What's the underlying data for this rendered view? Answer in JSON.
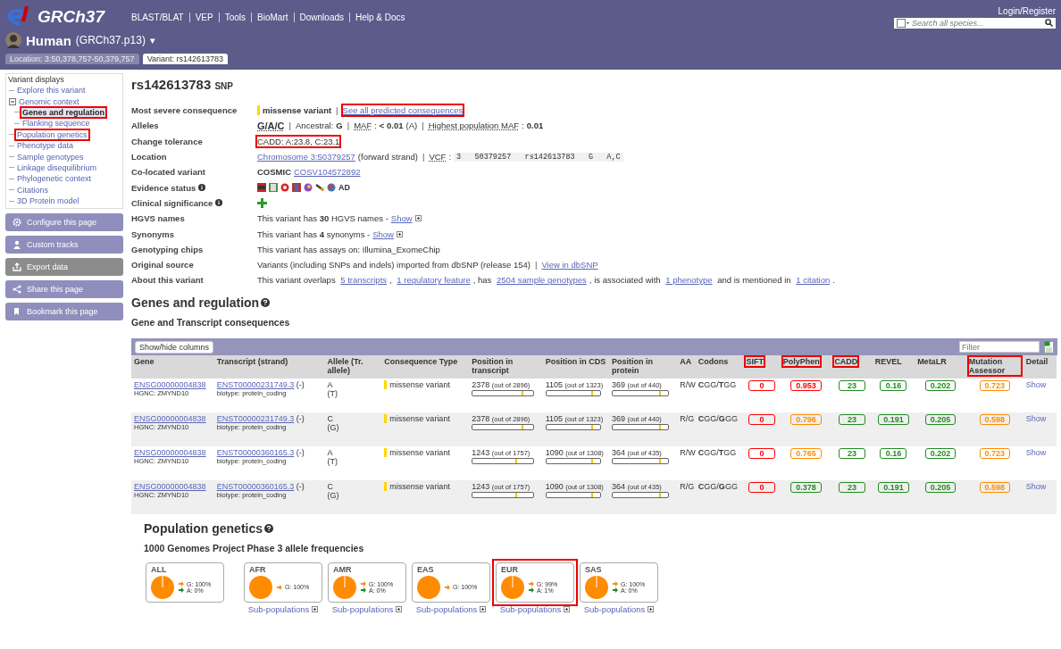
{
  "header": {
    "logo": "GRCh37",
    "nav": [
      "BLAST/BLAT",
      "VEP",
      "Tools",
      "BioMart",
      "Downloads",
      "Help & Docs"
    ],
    "login": "Login/Register",
    "search": {
      "placeholder": "Search all species..."
    },
    "species": "Human",
    "assembly": "(GRCh37.p13)",
    "caret": "▾"
  },
  "tabs": [
    {
      "label": "Location: 3:50,378,757-50,379,757",
      "selected": false
    },
    {
      "label": "Variant: rs142613783",
      "selected": true
    }
  ],
  "sidebar": {
    "title": "Variant displays",
    "items": [
      {
        "label": "Explore this variant",
        "selected": false,
        "highlighted": false
      },
      {
        "label": "Genomic context",
        "selected": false,
        "highlighted": false,
        "expanded": true,
        "children": [
          {
            "label": "Genes and regulation",
            "selected": true,
            "highlighted": true
          },
          {
            "label": "Flanking sequence",
            "selected": false,
            "highlighted": false
          }
        ]
      },
      {
        "label": "Population genetics",
        "selected": false,
        "highlighted": true
      },
      {
        "label": "Phenotype data",
        "selected": false,
        "highlighted": false
      },
      {
        "label": "Sample genotypes",
        "selected": false,
        "highlighted": false
      },
      {
        "label": "Linkage disequilibrium",
        "selected": false,
        "highlighted": false
      },
      {
        "label": "Phylogenetic context",
        "selected": false,
        "highlighted": false
      },
      {
        "label": "Citations",
        "selected": false,
        "highlighted": false
      },
      {
        "label": "3D Protein model",
        "selected": false,
        "highlighted": false
      }
    ],
    "buttons": [
      {
        "label": "Configure this page",
        "kind": "gear",
        "disabled": false
      },
      {
        "label": "Custom tracks",
        "kind": "tracks",
        "disabled": false
      },
      {
        "label": "Export data",
        "kind": "export",
        "disabled": true
      },
      {
        "label": "Share this page",
        "kind": "share",
        "disabled": false
      },
      {
        "label": "Bookmark this page",
        "kind": "bookmark",
        "disabled": false
      }
    ]
  },
  "variant": {
    "id": "rs142613783",
    "type": "SNP"
  },
  "summary": [
    {
      "label": "Most severe consequence",
      "info": false,
      "parts": [
        {
          "kind": "tag",
          "text": "missense variant",
          "color": "#ffd700"
        },
        {
          "kind": "sep",
          "text": "|"
        },
        {
          "kind": "link",
          "text": "See all predicted consequences",
          "highlighted": true
        }
      ]
    },
    {
      "label": "Alleles",
      "info": false,
      "parts": [
        {
          "kind": "boldabbr",
          "text": "G/A/C"
        },
        {
          "kind": "sep",
          "text": "|"
        },
        {
          "kind": "text",
          "text": "Ancestral:"
        },
        {
          "kind": "bold",
          "text": "G"
        },
        {
          "kind": "sep",
          "text": "|"
        },
        {
          "kind": "abbr",
          "text": "MAF"
        },
        {
          "kind": "text",
          "text": ":"
        },
        {
          "kind": "bold",
          "text": "< 0.01"
        },
        {
          "kind": "text",
          "text": "(A)"
        },
        {
          "kind": "sep",
          "text": "|"
        },
        {
          "kind": "abbr",
          "text": "Highest population MAF"
        },
        {
          "kind": "text",
          "text": ":"
        },
        {
          "kind": "bold",
          "text": "0.01"
        }
      ]
    },
    {
      "label": "Change tolerance",
      "info": false,
      "parts": [
        {
          "kind": "text",
          "text": "CADD: A:23.8, C:23.1",
          "highlighted": true
        }
      ]
    },
    {
      "label": "Location",
      "info": false,
      "parts": [
        {
          "kind": "link",
          "text": "Chromosome 3:50379257"
        },
        {
          "kind": "text",
          "text": "(forward strand)"
        },
        {
          "kind": "sep",
          "text": "|"
        },
        {
          "kind": "abbr",
          "text": "VCF"
        },
        {
          "kind": "text",
          "text": ":"
        },
        {
          "kind": "code",
          "text": "3   50379257   rs142613783   G   A,C"
        }
      ]
    },
    {
      "label": "Co-located variant",
      "info": false,
      "parts": [
        {
          "kind": "bold",
          "text": "COSMIC"
        },
        {
          "kind": "link",
          "text": "COSV104572892"
        }
      ]
    },
    {
      "label": "Evidence status",
      "info": true,
      "parts": [
        {
          "kind": "evidence",
          "text": "AD"
        }
      ]
    },
    {
      "label": "Clinical significance",
      "info": true,
      "parts": [
        {
          "kind": "plus"
        }
      ]
    },
    {
      "label": "HGVS names",
      "info": false,
      "parts": [
        {
          "kind": "rich",
          "text": "This variant has **30** HGVS names -"
        },
        {
          "kind": "link",
          "text": "Show"
        },
        {
          "kind": "toggle"
        }
      ]
    },
    {
      "label": "Synonyms",
      "info": false,
      "parts": [
        {
          "kind": "rich",
          "text": "This variant has **4** synonyms -"
        },
        {
          "kind": "link",
          "text": "Show"
        },
        {
          "kind": "toggle"
        }
      ]
    },
    {
      "label": "Genotyping chips",
      "info": false,
      "parts": [
        {
          "kind": "text",
          "text": "This variant has assays on: Illumina_ExomeChip"
        }
      ]
    },
    {
      "label": "Original source",
      "info": false,
      "parts": [
        {
          "kind": "text",
          "text": "Variants (including SNPs and indels) imported from dbSNP (release 154)"
        },
        {
          "kind": "sep",
          "text": "|"
        },
        {
          "kind": "extlink",
          "text": "View in dbSNP"
        }
      ]
    },
    {
      "label": "About this variant",
      "info": false,
      "parts": [
        {
          "kind": "text",
          "text": "This variant overlaps "
        },
        {
          "kind": "link",
          "text": "5 transcripts"
        },
        {
          "kind": "text",
          "text": ", "
        },
        {
          "kind": "link",
          "text": "1 regulatory feature"
        },
        {
          "kind": "text",
          "text": ", has "
        },
        {
          "kind": "link",
          "text": "2504 sample genotypes"
        },
        {
          "kind": "text",
          "text": ", is associated with "
        },
        {
          "kind": "link",
          "text": "1 phenotype"
        },
        {
          "kind": "text",
          "text": " and is mentioned in "
        },
        {
          "kind": "link",
          "text": "1 citation"
        },
        {
          "kind": "text",
          "text": "."
        }
      ]
    }
  ],
  "genes": {
    "title": "Genes and regulation",
    "subtitle": "Gene and Transcript consequences",
    "toolbar": {
      "button": "Show/hide columns",
      "filter": {
        "placeholder": "Filter"
      }
    },
    "columns": [
      {
        "label": "Gene",
        "highlighted": false
      },
      {
        "label": "Transcript (strand)",
        "highlighted": false
      },
      {
        "label": "Allele (Tr. allele)",
        "highlighted": false
      },
      {
        "label": "Consequence Type",
        "highlighted": false
      },
      {
        "label": "Position in transcript",
        "highlighted": false
      },
      {
        "label": "Position in CDS",
        "highlighted": false
      },
      {
        "label": "Position in protein",
        "highlighted": false
      },
      {
        "label": "AA",
        "highlighted": false
      },
      {
        "label": "Codons",
        "highlighted": false
      },
      {
        "label": "SIFT",
        "highlighted": true
      },
      {
        "label": "PolyPhen",
        "highlighted": true
      },
      {
        "label": "CADD",
        "highlighted": true
      },
      {
        "label": "REVEL",
        "highlighted": false
      },
      {
        "label": "MetaLR",
        "highlighted": false
      },
      {
        "label": "Mutation Assessor",
        "highlighted": true
      },
      {
        "label": "Detail",
        "highlighted": false
      }
    ],
    "rows": [
      {
        "gene": "ENSG00000004838",
        "hgnc": "HGNC: ZMYND10",
        "transcript": "ENST00000231749.3",
        "strand": "(-)",
        "biotype_label": "biotype:",
        "biotype": "protein_coding",
        "allele": "A",
        "tr_allele": "(T)",
        "consequence": {
          "text": "missense variant",
          "color": "#ffd700"
        },
        "positions": [
          {
            "value": "2378",
            "total": "(out of 2896)",
            "level": 0.82
          },
          {
            "value": "1105",
            "total": "(out of 1323)",
            "level": 0.84
          },
          {
            "value": "369",
            "total": "(out of 440)",
            "level": 0.84
          }
        ],
        "aa": "R/W",
        "codons": "**C**GG/**T**GG",
        "scores": [
          {
            "text": "0",
            "color": "#ff0000"
          },
          {
            "text": "0.953",
            "color": "#ff0000"
          },
          {
            "text": "23",
            "color": "#228b22"
          },
          {
            "text": "0.16",
            "color": "#228b22"
          },
          {
            "text": "0.202",
            "color": "#228b22"
          },
          {
            "text": "0.723",
            "color": "#ff8c00"
          }
        ],
        "detail": "Show"
      },
      {
        "gene": "ENSG00000004838",
        "hgnc": "HGNC: ZMYND10",
        "transcript": "ENST00000231749.3",
        "strand": "(-)",
        "biotype_label": "biotype:",
        "biotype": "protein_coding",
        "allele": "C",
        "tr_allele": "(G)",
        "consequence": {
          "text": "missense variant",
          "color": "#ffd700"
        },
        "positions": [
          {
            "value": "2378",
            "total": "(out of 2896)",
            "level": 0.82
          },
          {
            "value": "1105",
            "total": "(out of 1323)",
            "level": 0.84
          },
          {
            "value": "369",
            "total": "(out of 440)",
            "level": 0.84
          }
        ],
        "aa": "R/G",
        "codons": "**C**GG/**G**GG",
        "scores": [
          {
            "text": "0",
            "color": "#ff0000"
          },
          {
            "text": "0.796",
            "color": "#ff8c00"
          },
          {
            "text": "23",
            "color": "#228b22"
          },
          {
            "text": "0.191",
            "color": "#228b22"
          },
          {
            "text": "0.205",
            "color": "#228b22"
          },
          {
            "text": "0.598",
            "color": "#ff8c00"
          }
        ],
        "detail": "Show"
      },
      {
        "gene": "ENSG00000004838",
        "hgnc": "HGNC: ZMYND10",
        "transcript": "ENST00000360165.3",
        "strand": "(-)",
        "biotype_label": "biotype:",
        "biotype": "protein_coding",
        "allele": "A",
        "tr_allele": "(T)",
        "consequence": {
          "text": "missense variant",
          "color": "#ffd700"
        },
        "positions": [
          {
            "value": "1243",
            "total": "(out of 1757)",
            "level": 0.71
          },
          {
            "value": "1090",
            "total": "(out of 1308)",
            "level": 0.83
          },
          {
            "value": "364",
            "total": "(out of 435)",
            "level": 0.84
          }
        ],
        "aa": "R/W",
        "codons": "**C**GG/**T**GG",
        "scores": [
          {
            "text": "0",
            "color": "#ff0000"
          },
          {
            "text": "0.765",
            "color": "#ff8c00"
          },
          {
            "text": "23",
            "color": "#228b22"
          },
          {
            "text": "0.16",
            "color": "#228b22"
          },
          {
            "text": "0.202",
            "color": "#228b22"
          },
          {
            "text": "0.723",
            "color": "#ff8c00"
          }
        ],
        "detail": "Show"
      },
      {
        "gene": "ENSG00000004838",
        "hgnc": "HGNC: ZMYND10",
        "transcript": "ENST00000360165.3",
        "strand": "(-)",
        "biotype_label": "biotype:",
        "biotype": "protein_coding",
        "allele": "C",
        "tr_allele": "(G)",
        "consequence": {
          "text": "missense variant",
          "color": "#ffd700"
        },
        "positions": [
          {
            "value": "1243",
            "total": "(out of 1757)",
            "level": 0.71
          },
          {
            "value": "1090",
            "total": "(out of 1308)",
            "level": 0.83
          },
          {
            "value": "364",
            "total": "(out of 435)",
            "level": 0.84
          }
        ],
        "aa": "R/G",
        "codons": "**C**GG/**G**GG",
        "scores": [
          {
            "text": "0",
            "color": "#ff0000"
          },
          {
            "text": "0.378",
            "color": "#228b22"
          },
          {
            "text": "23",
            "color": "#228b22"
          },
          {
            "text": "0.191",
            "color": "#228b22"
          },
          {
            "text": "0.205",
            "color": "#228b22"
          },
          {
            "text": "0.598",
            "color": "#ff8c00"
          }
        ],
        "detail": "Show"
      }
    ]
  },
  "population": {
    "title": "Population genetics",
    "subtitle": "1000 Genomes Project Phase 3 allele frequencies",
    "groups": [
      {
        "name": "ALL",
        "highlighted": false,
        "alleles": [
          {
            "label": "G: 100%",
            "color": "#ff8c00"
          },
          {
            "label": "A: 0%",
            "color": "#228b22"
          }
        ]
      },
      {
        "name": "AFR",
        "highlighted": false,
        "alleles": [
          {
            "label": "G: 100%",
            "color": "#ff8c00"
          }
        ],
        "link": "Sub-populations"
      },
      {
        "name": "AMR",
        "highlighted": false,
        "alleles": [
          {
            "label": "G: 100%",
            "color": "#ff8c00"
          },
          {
            "label": "A: 0%",
            "color": "#228b22"
          }
        ],
        "link": "Sub-populations"
      },
      {
        "name": "EAS",
        "highlighted": false,
        "alleles": [
          {
            "label": "G: 100%",
            "color": "#ff8c00"
          }
        ],
        "link": "Sub-populations"
      },
      {
        "name": "EUR",
        "highlighted": true,
        "alleles": [
          {
            "label": "G: 99%",
            "color": "#ff8c00"
          },
          {
            "label": "A: 1%",
            "color": "#228b22"
          }
        ],
        "link": "Sub-populations"
      },
      {
        "name": "SAS",
        "highlighted": false,
        "alleles": [
          {
            "label": "G: 100%",
            "color": "#ff8c00"
          },
          {
            "label": "A: 0%",
            "color": "#228b22"
          }
        ],
        "link": "Sub-populations"
      }
    ]
  }
}
